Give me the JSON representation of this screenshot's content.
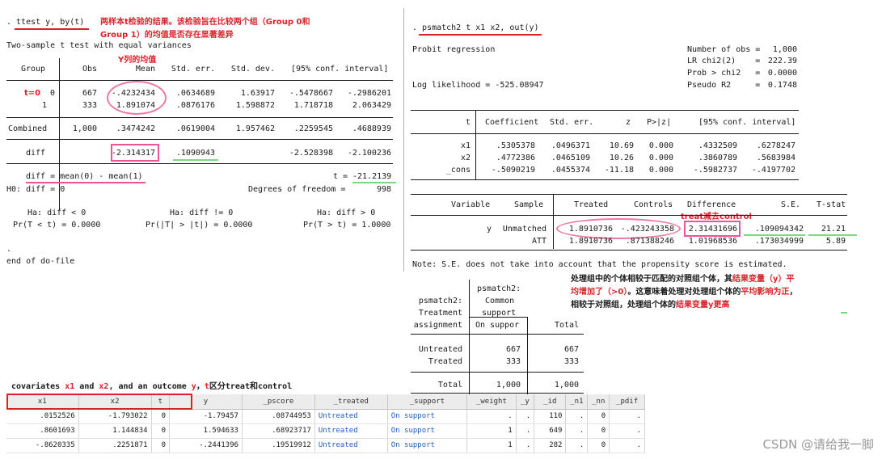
{
  "ttest": {
    "command": ". ttest y, by(t)",
    "note_line1": "两样本t检验的结果。该检验旨在比较两个组（Group 0和",
    "note_line2": "Group 1）的均值是否存在显著差异",
    "title": "Two-sample t test with equal variances",
    "mean_note": "Y列的均值",
    "headers": [
      "Group",
      "Obs",
      "Mean",
      "Std. err.",
      "Std. dev.",
      "[95% conf. interval]"
    ],
    "rows": [
      {
        "group": "0",
        "obs": "667",
        "mean": "-.4232434",
        "se": ".0634689",
        "sd": "1.63917",
        "lo": "-.5478667",
        "hi": "-.2986201"
      },
      {
        "group": "1",
        "obs": "333",
        "mean": "1.891074",
        "se": ".0876176",
        "sd": "1.598872",
        "lo": "1.718718",
        "hi": "2.063429"
      }
    ],
    "group_note": "t=0",
    "combined": {
      "group": "Combined",
      "obs": "1,000",
      "mean": ".3474242",
      "se": ".0619004",
      "sd": "1.957462",
      "lo": ".2259545",
      "hi": ".4688939"
    },
    "diff": {
      "group": "diff",
      "mean": "-2.314317",
      "se": ".1090943",
      "lo": "-2.528398",
      "hi": "-2.100236"
    },
    "diff_def": "diff = mean(0) - mean(1)",
    "t_label": "t =",
    "t_value": "-21.2139",
    "h0": "H0: diff = 0",
    "dof_label": "Degrees of freedom =",
    "dof_value": "998",
    "ha1": "Ha: diff < 0",
    "ha2": "Ha: diff != 0",
    "ha3": "Ha: diff > 0",
    "p1": "Pr(T < t) = 0.0000",
    "p2": "Pr(|T| > |t|) = 0.0000",
    "p3": "Pr(T > t) = 1.0000",
    "dot": ".",
    "end": "end of do-file"
  },
  "psm": {
    "command": ". psmatch2 t x1 x2, out(y)",
    "probit": "Probit regression",
    "stats": [
      {
        "label": "Number of obs =",
        "value": "1,000"
      },
      {
        "label": "LR chi2(2)    =",
        "value": "222.39"
      },
      {
        "label": "Prob > chi2   =",
        "value": "0.0000"
      },
      {
        "label": "Pseudo R2     =",
        "value": "0.1748"
      }
    ],
    "loglik": "Log likelihood = -525.08947",
    "coef_headers": [
      "t",
      "Coefficient",
      "Std. err.",
      "z",
      "P>|z|",
      "[95% conf. interval]"
    ],
    "coef_rows": [
      {
        "var": "x1",
        "coef": ".5305378",
        "se": ".0496371",
        "z": "10.69",
        "p": "0.000",
        "lo": ".4332509",
        "hi": ".6278247"
      },
      {
        "var": "x2",
        "coef": ".4772386",
        "se": ".0465109",
        "z": "10.26",
        "p": "0.000",
        "lo": ".3860789",
        "hi": ".5683984"
      },
      {
        "var": "_cons",
        "coef": "-.5090219",
        "se": ".0455374",
        "z": "-11.18",
        "p": "0.000",
        "lo": "-.5982737",
        "hi": "-.4197702"
      }
    ],
    "att_headers": [
      "Variable",
      "Sample",
      "Treated",
      "Controls",
      "Difference",
      "S.E.",
      "T-stat"
    ],
    "diff_note": "treat减去control",
    "att_rows": [
      {
        "var": "y",
        "sample": "Unmatched",
        "treated": "1.8910736",
        "controls": "-.423243358",
        "diff": "2.31431696",
        "se": ".109094342",
        "t": "21.21"
      },
      {
        "var": "",
        "sample": "ATT",
        "treated": "1.8910736",
        "controls": ".871388246",
        "diff": "1.01968536",
        "se": ".173034999",
        "t": "5.89"
      }
    ],
    "note": "Note: S.E. does not take into account that the propensity score is estimated.",
    "explain": [
      {
        "parts": [
          [
            "k",
            "处理组中的个体相较于匹配的对照组个体，其"
          ],
          [
            "r",
            "结果变量（y）平"
          ]
        ]
      },
      {
        "parts": [
          [
            "r",
            "均增加了（>0）"
          ],
          [
            "k",
            "。这意味着处理对处理组个体的"
          ],
          [
            "r",
            "平均影响为正"
          ],
          [
            "k",
            "，"
          ]
        ]
      },
      {
        "parts": [
          [
            "k",
            "相较于对照组，处理组个体的"
          ],
          [
            "r",
            "结果变量y更高"
          ]
        ]
      }
    ],
    "support": {
      "h_left": [
        "psmatch2:",
        "Treatment",
        "assignment"
      ],
      "h_mid": [
        "psmatch2:",
        "Common",
        "support"
      ],
      "h_mid2": "On suppor",
      "h_total": "Total",
      "rows": [
        {
          "label": "Untreated",
          "on": "667",
          "total": "667"
        },
        {
          "label": "Treated",
          "on": "333",
          "total": "333"
        }
      ],
      "total": {
        "label": "Total",
        "on": "1,000",
        "total": "1,000"
      }
    }
  },
  "data_editor": {
    "caption_parts": [
      [
        "k",
        "covariates "
      ],
      [
        "r",
        "x1"
      ],
      [
        "k",
        " and "
      ],
      [
        "r",
        "x2"
      ],
      [
        "k",
        ", and an outcome "
      ],
      [
        "r",
        "y"
      ],
      [
        "k",
        "，"
      ],
      [
        "r",
        "t"
      ],
      [
        "k",
        "区分treat和control"
      ]
    ],
    "columns": [
      "x1",
      "x2",
      "t",
      "y",
      "_pscore",
      "_treated",
      "_support",
      "_weight",
      "_y",
      "_id",
      "_n1",
      "_nn",
      "_pdif"
    ],
    "rows": [
      [
        ".0152526",
        "-1.793022",
        "0",
        "-1.79457",
        ".08744953",
        "Untreated",
        "On support",
        ".",
        ".",
        "110",
        ".",
        "0",
        "."
      ],
      [
        ".8601693",
        "1.144834",
        "0",
        "1.594633",
        ".68923717",
        "Untreated",
        "On support",
        "1",
        ".",
        "649",
        ".",
        "0",
        "."
      ],
      [
        "-.8620335",
        ".2251871",
        "0",
        "-.2441396",
        ".19519912",
        "Untreated",
        "On support",
        "1",
        ".",
        "282",
        ".",
        "0",
        "."
      ]
    ]
  },
  "watermark": "CSDN @请给我一脚",
  "colors": {
    "annotation_red": "#d8232a",
    "annotation_pink": "#e8559a",
    "annotation_green": "#7fd67f",
    "link_blue": "#1f5fbf"
  }
}
